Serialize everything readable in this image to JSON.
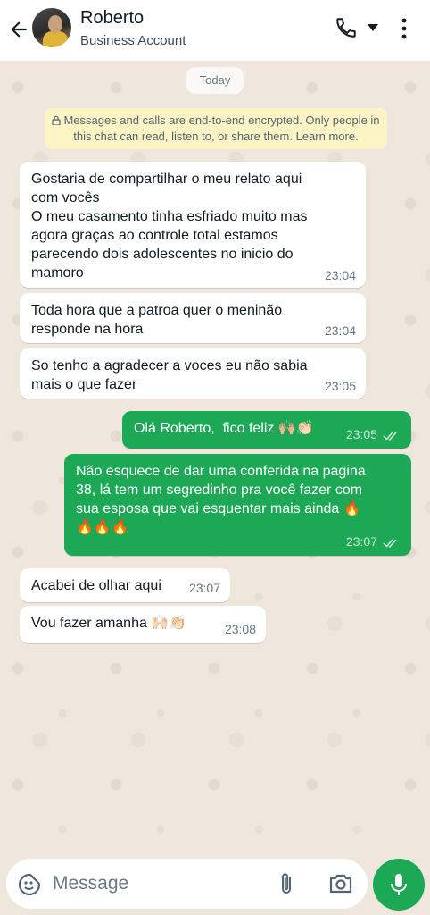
{
  "header": {
    "contact_name": "Roberto",
    "contact_subtitle": "Business Account"
  },
  "chat": {
    "date_pill": "Today",
    "encryption_notice": "Messages and calls are end-to-end encrypted. Only people in this chat can read, listen to, or share them. Learn more."
  },
  "messages": [
    {
      "direction": "incoming",
      "text": "Gostaria de compartilhar o meu relato aqui\ncom vocês\nO meu casamento tinha esfriado muito mas\nagora graças ao controle total estamos\nparecendo dois adolescentes no inicio do\nmamoro",
      "time": "23:04"
    },
    {
      "direction": "incoming",
      "text": "Toda hora que a patroa quer o meninão\nresponde na hora",
      "time": "23:04"
    },
    {
      "direction": "incoming",
      "text": "So tenho a agradecer a voces eu não sabia\nmais o que fazer",
      "time": "23:05"
    },
    {
      "direction": "outgoing",
      "text": "Olá Roberto,  fico feliz 🙌🏼👏🏻",
      "time": "23:05",
      "status": "read"
    },
    {
      "direction": "outgoing",
      "text": "Não esquece de dar uma conferida na pagina\n38, lá tem um segredinho pra você fazer com\nsua esposa que vai esquentar mais ainda 🔥\n🔥🔥🔥",
      "time": "23:07",
      "status": "read"
    },
    {
      "direction": "incoming",
      "text": "Acabei de olhar aqui",
      "time": "23:07"
    },
    {
      "direction": "incoming",
      "text": "Vou fazer amanha 🙌🏻👏🏻",
      "time": "23:08"
    }
  ],
  "composer": {
    "placeholder": "Message"
  },
  "icons": {
    "back": "arrow-left-icon",
    "call": "phone-icon",
    "call_menu": "caret-down-icon",
    "menu": "more-vert-icon",
    "emoji": "sticker-icon",
    "attach": "paperclip-icon",
    "camera": "camera-icon",
    "mic": "mic-icon"
  },
  "colors": {
    "accent": "#1da856",
    "chat_bg": "#efe7de",
    "incoming_bubble": "#ffffff",
    "encryption_bg": "#fdf4c5"
  }
}
